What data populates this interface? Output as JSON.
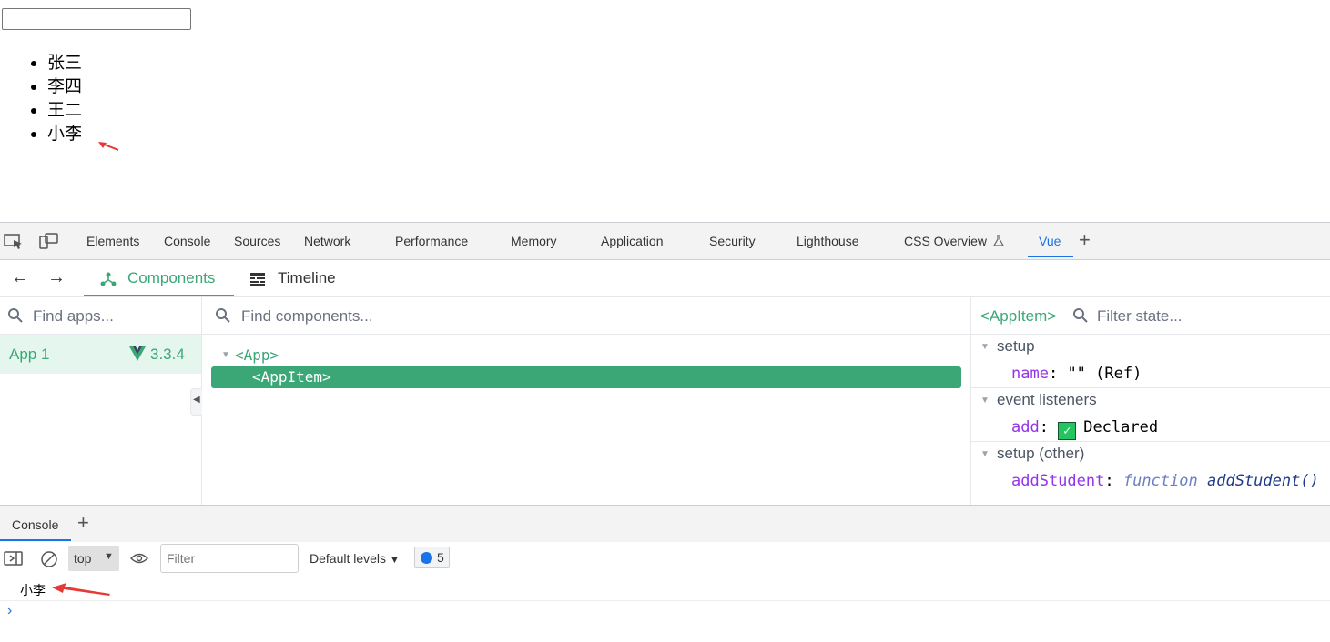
{
  "page": {
    "input_value": "",
    "list_items": [
      "张三",
      "李四",
      "王二",
      "小李"
    ]
  },
  "devtools": {
    "tabs": [
      "Elements",
      "Console",
      "Sources",
      "Network",
      "Performance",
      "Memory",
      "Application",
      "Security",
      "Lighthouse",
      "CSS Overview",
      "Vue"
    ],
    "active_tab": "Vue"
  },
  "vue": {
    "tabs": {
      "components": "Components",
      "timeline": "Timeline"
    },
    "apps_search_placeholder": "Find apps...",
    "components_search_placeholder": "Find components...",
    "state_search_placeholder": "Filter state...",
    "app": {
      "name": "App 1",
      "version": "3.3.4"
    },
    "tree": {
      "root": "<App>",
      "child": "<AppItem>"
    },
    "selected_component": "<AppItem>",
    "state": {
      "setup": {
        "title": "setup",
        "key": "name",
        "value": "\"\"",
        "type": "(Ref)"
      },
      "event_listeners": {
        "title": "event listeners",
        "key": "add",
        "value": "Declared"
      },
      "setup_other": {
        "title": "setup (other)",
        "key": "addStudent",
        "keyword": "function",
        "fn_name": "addStudent()"
      }
    },
    "colors": {
      "accent": "#3ba776",
      "key_purple": "#9333ea"
    }
  },
  "console": {
    "drawer_tab": "Console",
    "context": "top",
    "filter_placeholder": "Filter",
    "levels": "Default levels",
    "message_count": "5",
    "messages": [
      "小李"
    ]
  }
}
